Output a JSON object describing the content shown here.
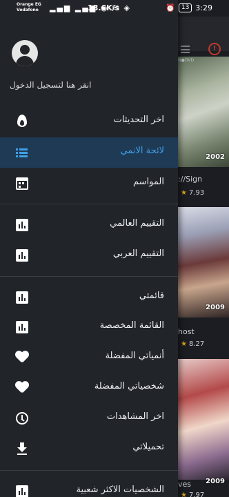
{
  "status_bar": {
    "carrier1": "Orange EG",
    "carrier2": "Vodafone",
    "speed": "18.6K/s",
    "battery": "13",
    "time": "3:29"
  },
  "drawer": {
    "login_text": "انقر هنا لتسجيل الدخول",
    "items": [
      {
        "label": "اخر التحديثات",
        "icon": "flame-icon"
      },
      {
        "label": "لائحة الانمي",
        "icon": "list-icon",
        "active": true
      },
      {
        "label": "المواسم",
        "icon": "calendar-icon"
      },
      {
        "label": "التقييم العالمي",
        "icon": "bar-chart-icon"
      },
      {
        "label": "التقييم العربي",
        "icon": "bar-chart-icon"
      },
      {
        "label": "قائمتي",
        "icon": "bar-chart-icon"
      },
      {
        "label": "القائمة المخصصة",
        "icon": "bar-chart-icon"
      },
      {
        "label": "أنمياتي المفضلة",
        "icon": "heart-icon"
      },
      {
        "label": "شخصياتي المفضلة",
        "icon": "heart-icon"
      },
      {
        "label": "اخر المشاهدات",
        "icon": "clock-icon"
      },
      {
        "label": "تحميلاتي",
        "icon": "download-icon"
      },
      {
        "label": "الشخصيات الاكثر شعبية",
        "icon": "bar-chart-icon"
      }
    ]
  },
  "background": {
    "posters": [
      {
        "year": "2002",
        "title": "://Sign",
        "rating": "7.93",
        "tag": "N●OVD"
      },
      {
        "year": "2009",
        "title": "host",
        "rating": "8.27"
      },
      {
        "year": "2009",
        "title": "ves",
        "rating": "7.97"
      }
    ]
  },
  "colors": {
    "accent": "#3fa0e8",
    "drawer_bg": "#212429",
    "active_bg": "#1f3a55",
    "star": "#d4a11b",
    "alert": "#c0392b"
  }
}
